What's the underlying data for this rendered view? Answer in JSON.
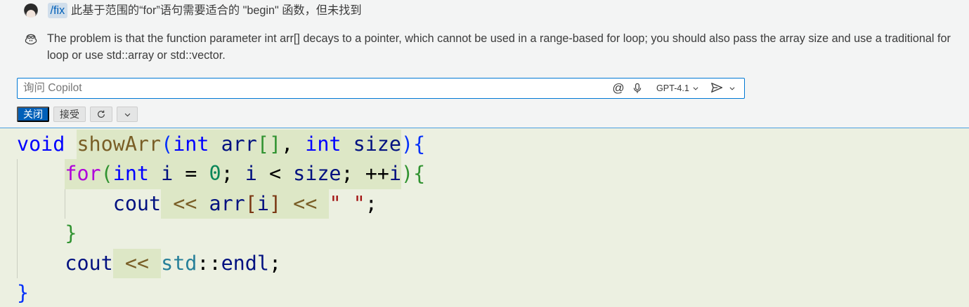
{
  "theme": {
    "accent": "#005fb8",
    "focus_border": "#0078d4",
    "diff_zone_border": "#4a9fe0",
    "diff_inserted_line": "#ecf0e1",
    "diff_inserted_text": "#dde7c6",
    "panel_background": "#f3f4f4",
    "foreground": "#3b3b3b"
  },
  "icons": {
    "user": "user-avatar",
    "assistant": "copilot-icon",
    "voice": "microphone-icon",
    "model_dropdown": "chevron-down-icon",
    "send": "send-icon",
    "send_options": "chevron-down-icon",
    "rerun": "refresh-icon",
    "more_actions": "chevron-down-icon"
  },
  "chat": {
    "request": {
      "command": "/fix",
      "text": "此基于范围的“for”语句需要适合的 \"begin\" 函数，但未找到"
    },
    "response": {
      "text": "The problem is that the function parameter int arr[] decays to a pointer, which cannot be used in a range-based for loop; you should also pass the array size and use a traditional for loop or use std::array or std::vector."
    }
  },
  "input": {
    "placeholder": "询问 Copilot",
    "mention_symbol": "@",
    "model": "GPT-4.1"
  },
  "actions": {
    "close": "关闭",
    "accept": "接受"
  },
  "editor": {
    "lines": [
      {
        "tokens": [
          {
            "t": "void",
            "c": "#0000ff"
          },
          {
            "t": " ",
            "c": "#000000"
          },
          {
            "t": "showArr",
            "c": "#795e26",
            "hl": true
          },
          {
            "t": "(",
            "c": "#0431fa",
            "hl": true
          },
          {
            "t": "int",
            "c": "#0000ff",
            "hl": true
          },
          {
            "t": " ",
            "c": "#000000",
            "hl": true
          },
          {
            "t": "arr",
            "c": "#001080",
            "hl": true
          },
          {
            "t": "[]",
            "c": "#319331",
            "hl": true
          },
          {
            "t": ", ",
            "c": "#000000",
            "hl": true
          },
          {
            "t": "int",
            "c": "#0000ff",
            "hl": true
          },
          {
            "t": " ",
            "c": "#000000",
            "hl": true
          },
          {
            "t": "size",
            "c": "#001080",
            "hl": true
          },
          {
            "t": ")",
            "c": "#0431fa"
          },
          {
            "t": "{",
            "c": "#0431fa"
          }
        ]
      },
      {
        "tokens": [
          {
            "t": "    ",
            "c": "#000000"
          },
          {
            "t": "for",
            "c": "#af00db",
            "hl": true
          },
          {
            "t": "(",
            "c": "#319331",
            "hl": true
          },
          {
            "t": "int",
            "c": "#0000ff",
            "hl": true
          },
          {
            "t": " ",
            "c": "#000000",
            "hl": true
          },
          {
            "t": "i",
            "c": "#001080",
            "hl": true
          },
          {
            "t": " = ",
            "c": "#000000",
            "hl": true
          },
          {
            "t": "0",
            "c": "#098658",
            "hl": true
          },
          {
            "t": "; ",
            "c": "#000000",
            "hl": true
          },
          {
            "t": "i",
            "c": "#001080",
            "hl": true
          },
          {
            "t": " < ",
            "c": "#000000",
            "hl": true
          },
          {
            "t": "size",
            "c": "#001080",
            "hl": true
          },
          {
            "t": "; ++",
            "c": "#000000",
            "hl": true
          },
          {
            "t": "i",
            "c": "#001080",
            "hl": true
          },
          {
            "t": ")",
            "c": "#319331"
          },
          {
            "t": "{",
            "c": "#319331"
          }
        ]
      },
      {
        "tokens": [
          {
            "t": "        ",
            "c": "#000000"
          },
          {
            "t": "cout",
            "c": "#001080"
          },
          {
            "t": " ",
            "c": "#000000",
            "hl": true
          },
          {
            "t": "<<",
            "c": "#795e26",
            "hl": true
          },
          {
            "t": " ",
            "c": "#000000",
            "hl": true
          },
          {
            "t": "arr",
            "c": "#001080",
            "hl": true
          },
          {
            "t": "[",
            "c": "#7b3814",
            "hl": true
          },
          {
            "t": "i",
            "c": "#001080",
            "hl": true
          },
          {
            "t": "]",
            "c": "#7b3814",
            "hl": true
          },
          {
            "t": " ",
            "c": "#000000",
            "hl": true
          },
          {
            "t": "<<",
            "c": "#795e26",
            "hl": true
          },
          {
            "t": " ",
            "c": "#000000",
            "hl": true
          },
          {
            "t": "\" \"",
            "c": "#a31515"
          },
          {
            "t": ";",
            "c": "#000000"
          }
        ]
      },
      {
        "tokens": [
          {
            "t": "    ",
            "c": "#000000"
          },
          {
            "t": "}",
            "c": "#319331"
          }
        ]
      },
      {
        "tokens": [
          {
            "t": "    ",
            "c": "#000000"
          },
          {
            "t": "cout",
            "c": "#001080"
          },
          {
            "t": " ",
            "c": "#000000",
            "hl": true
          },
          {
            "t": "<<",
            "c": "#795e26",
            "hl": true
          },
          {
            "t": " ",
            "c": "#000000",
            "hl": true
          },
          {
            "t": "std",
            "c": "#267f99"
          },
          {
            "t": "::",
            "c": "#000000"
          },
          {
            "t": "endl",
            "c": "#001080"
          },
          {
            "t": ";",
            "c": "#000000"
          }
        ]
      },
      {
        "tokens": [
          {
            "t": "}",
            "c": "#0431fa"
          }
        ]
      }
    ]
  }
}
